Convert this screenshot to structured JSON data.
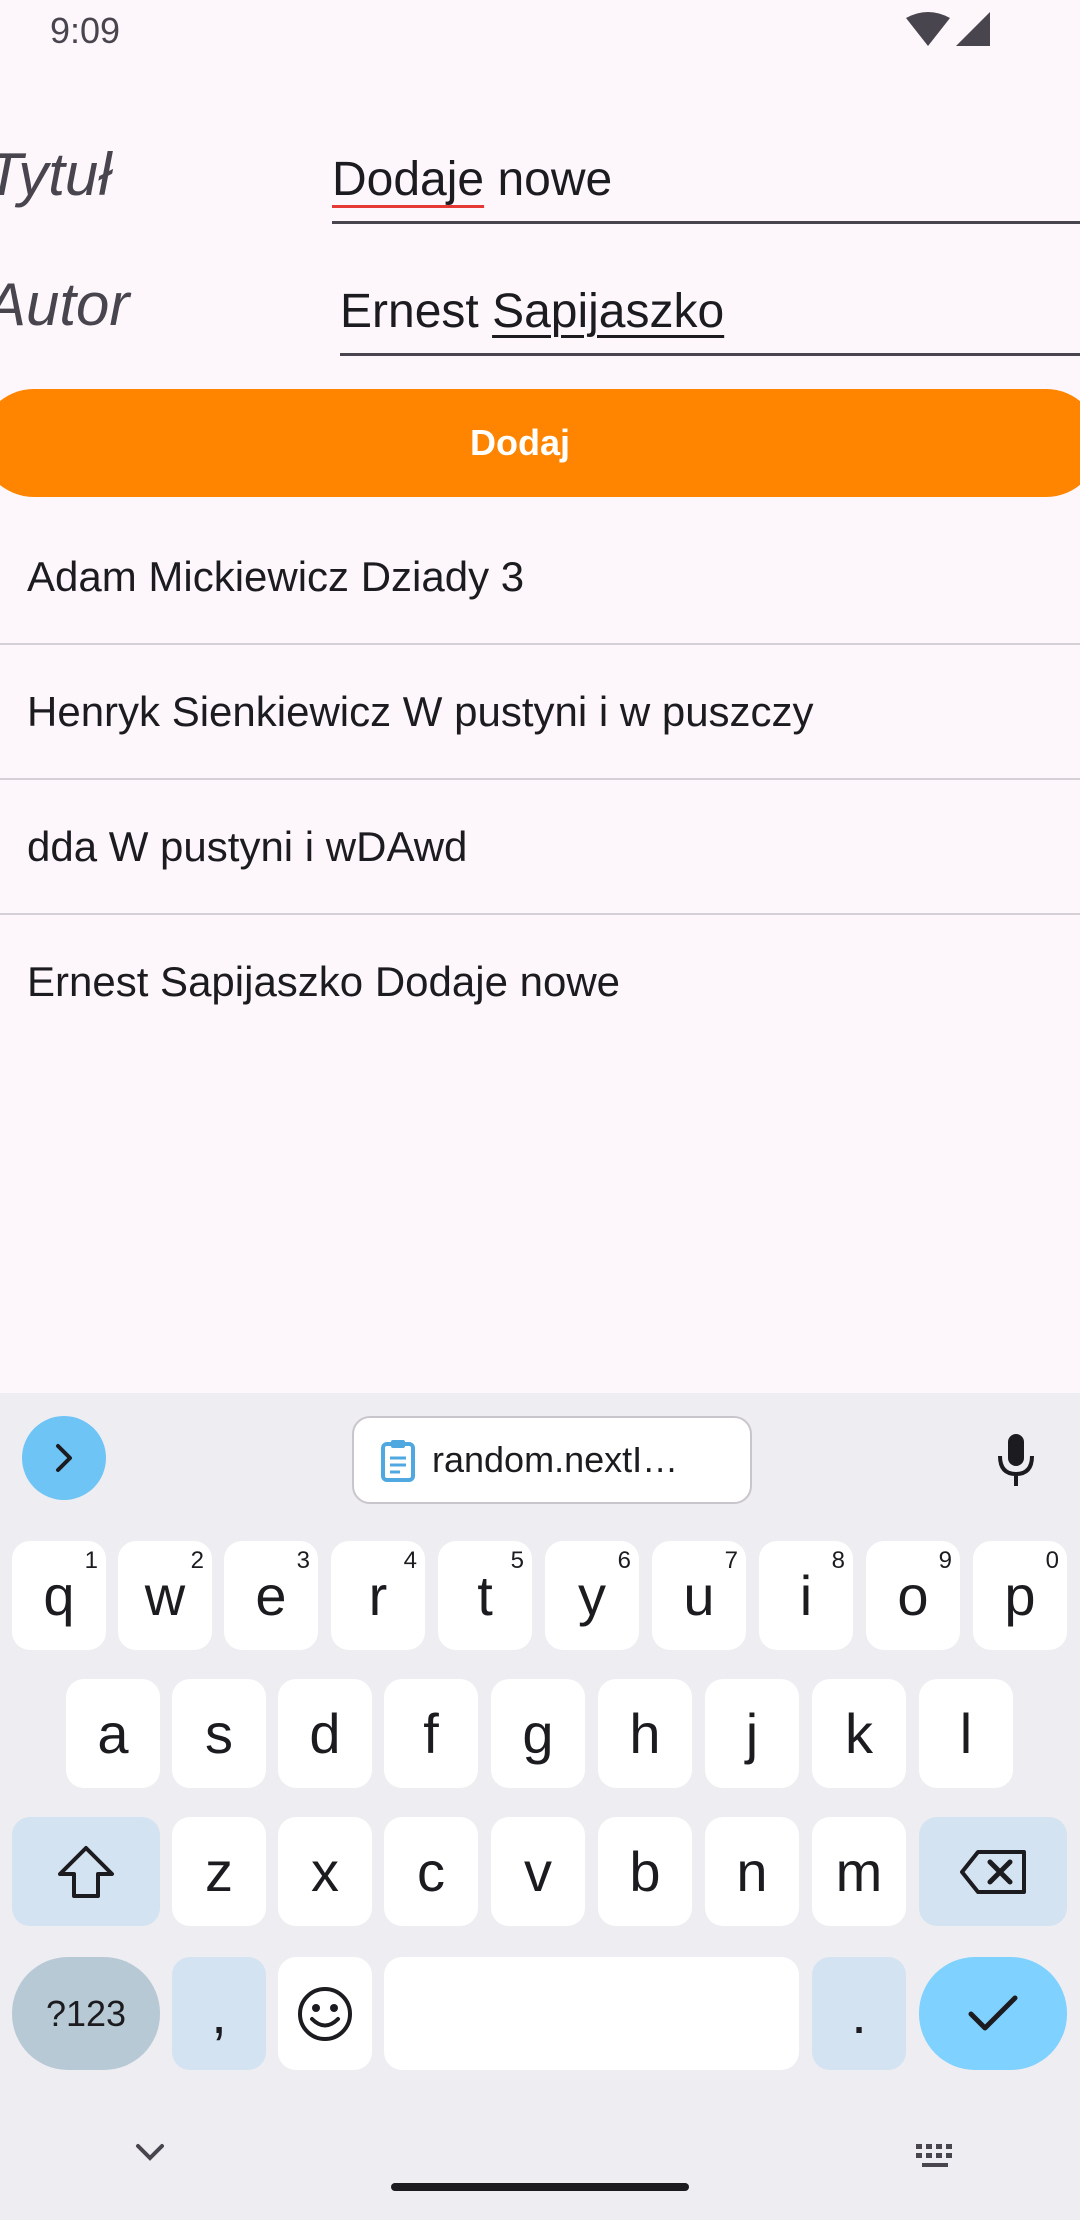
{
  "status_bar": {
    "time": "9:09"
  },
  "form": {
    "title_label": "Tytuł",
    "title_value_part1": "Dodaje",
    "title_value_part2": " nowe",
    "author_label": "Autor",
    "author_value_part1": "Ernest ",
    "author_value_part2": "Sapijaszko",
    "add_button_label": "Dodaj"
  },
  "books": [
    "Adam Mickiewicz Dziady 3",
    "Henryk Sienkiewicz W pustyni i w puszczy",
    "dda W pustyni i wDAwd",
    "Ernest Sapijaszko Dodaje nowe"
  ],
  "keyboard": {
    "clipboard_suggestion": "random.nextI…",
    "row1": [
      {
        "key": "q",
        "hint": "1"
      },
      {
        "key": "w",
        "hint": "2"
      },
      {
        "key": "e",
        "hint": "3"
      },
      {
        "key": "r",
        "hint": "4"
      },
      {
        "key": "t",
        "hint": "5"
      },
      {
        "key": "y",
        "hint": "6"
      },
      {
        "key": "u",
        "hint": "7"
      },
      {
        "key": "i",
        "hint": "8"
      },
      {
        "key": "o",
        "hint": "9"
      },
      {
        "key": "p",
        "hint": "0"
      }
    ],
    "row2": [
      "a",
      "s",
      "d",
      "f",
      "g",
      "h",
      "j",
      "k",
      "l"
    ],
    "row3": [
      "z",
      "x",
      "c",
      "v",
      "b",
      "n",
      "m"
    ],
    "symbols_label": "?123",
    "comma": ",",
    "period": "."
  },
  "colors": {
    "accent": "#ff8500",
    "background": "#fdf7fb",
    "enter_key": "#7fd1ff"
  }
}
